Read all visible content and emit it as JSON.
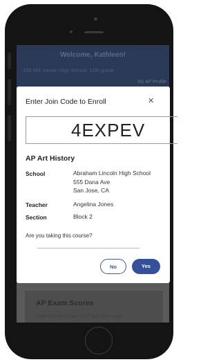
{
  "background": {
    "welcome": "Welcome, Kathleen!",
    "school_line": "Old Mill Senior High School, 12th grade",
    "ap_link": "My AP Profile",
    "card_title": "AP Exam Scores",
    "card_sub": "View and send your 2017 and prior year"
  },
  "modal": {
    "title": "Enter Join Code to Enroll",
    "close_glyph": "✕",
    "join_code": "4EXPEV",
    "course_name": "AP Art History",
    "school_label": "School",
    "school_lines": [
      "Abraham Lincoln High School",
      "555 Dana Ave",
      "San Jose, CA"
    ],
    "teacher_label": "Teacher",
    "teacher_value": "Angelina Jones",
    "section_label": "Section",
    "section_value": "Block 2",
    "question": "Are you taking this course?",
    "no_label": "No",
    "yes_label": "Yes"
  },
  "colors": {
    "primary": "#34509a",
    "header_bg": "#2a3957",
    "phone_body": "#141414"
  }
}
